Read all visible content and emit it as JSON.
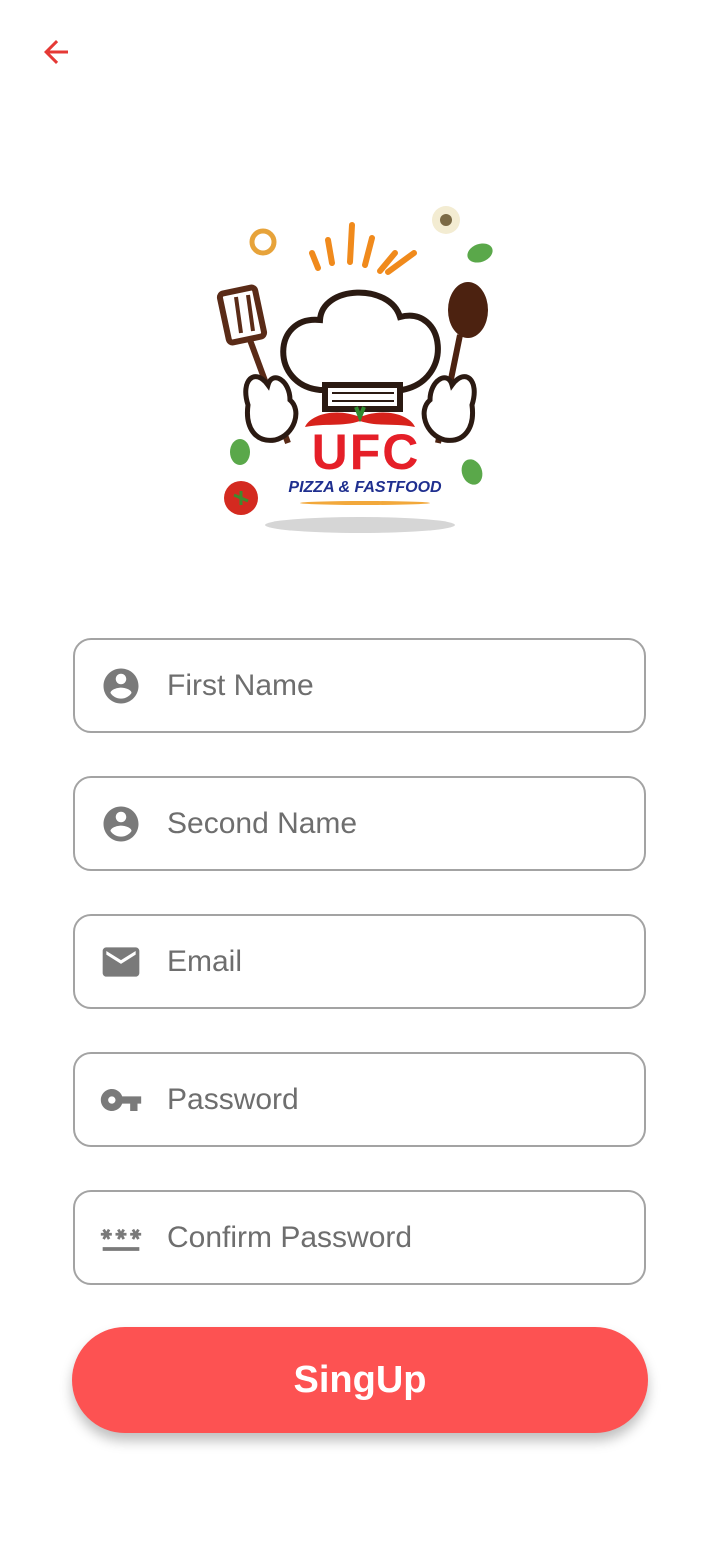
{
  "nav": {
    "back_icon": "arrow-back-icon",
    "accent": "#e53935"
  },
  "logo": {
    "brand": "UFC",
    "tagline": "PIZZA & FASTFOOD",
    "brand_color": "#e51f28",
    "tagline_color": "#1f2f8f"
  },
  "form": {
    "first_name": {
      "placeholder": "First Name",
      "value": "",
      "icon": "person-icon"
    },
    "second_name": {
      "placeholder": "Second Name",
      "value": "",
      "icon": "person-icon"
    },
    "email": {
      "placeholder": "Email",
      "value": "",
      "icon": "mail-icon"
    },
    "password": {
      "placeholder": "Password",
      "value": "",
      "icon": "key-icon"
    },
    "confirm_password": {
      "placeholder": "Confirm Password",
      "value": "",
      "icon": "password-dots-icon"
    }
  },
  "submit": {
    "label": "SingUp",
    "color": "#fd5252"
  }
}
